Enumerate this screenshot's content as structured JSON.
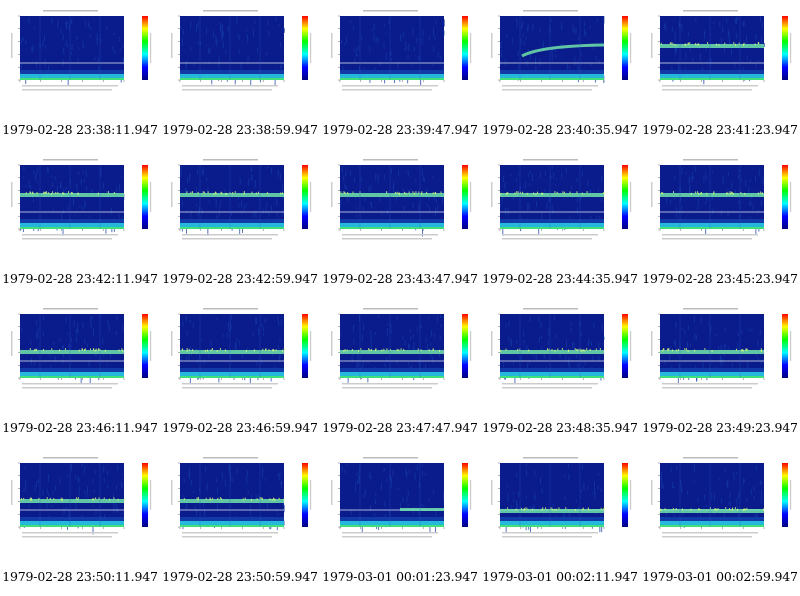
{
  "gallery": {
    "items": [
      {
        "caption": "1979-02-28 23:38:11.947",
        "band": "none"
      },
      {
        "caption": "1979-02-28 23:38:59.947",
        "band": "none"
      },
      {
        "caption": "1979-02-28 23:39:47.947",
        "band": "none"
      },
      {
        "caption": "1979-02-28 23:40:35.947",
        "band": "rising"
      },
      {
        "caption": "1979-02-28 23:41:23.947",
        "band": "high"
      },
      {
        "caption": "1979-02-28 23:42:11.947",
        "band": "high"
      },
      {
        "caption": "1979-02-28 23:42:59.947",
        "band": "high"
      },
      {
        "caption": "1979-02-28 23:43:47.947",
        "band": "high"
      },
      {
        "caption": "1979-02-28 23:44:35.947",
        "band": "high"
      },
      {
        "caption": "1979-02-28 23:45:23.947",
        "band": "high"
      },
      {
        "caption": "1979-02-28 23:46:11.947",
        "band": "mid"
      },
      {
        "caption": "1979-02-28 23:46:59.947",
        "band": "mid"
      },
      {
        "caption": "1979-02-28 23:47:47.947",
        "band": "mid"
      },
      {
        "caption": "1979-02-28 23:48:35.947",
        "band": "mid"
      },
      {
        "caption": "1979-02-28 23:49:23.947",
        "band": "mid"
      },
      {
        "caption": "1979-02-28 23:50:11.947",
        "band": "mid"
      },
      {
        "caption": "1979-02-28 23:50:59.947",
        "band": "mid"
      },
      {
        "caption": "1979-03-01 00:01:23.947",
        "band": "short"
      },
      {
        "caption": "1979-03-01 00:02:11.947",
        "band": "low"
      },
      {
        "caption": "1979-03-01 00:02:59.947",
        "band": "low"
      }
    ]
  },
  "colors": {
    "background": "#0a1b8c",
    "noise": "#123aa6",
    "band": "#6fe3a8",
    "floor": "#2bd8e8",
    "colorbar": [
      "#ff0000",
      "#ffff00",
      "#00ff00",
      "#00ffff",
      "#0000ff",
      "#00007f"
    ]
  }
}
